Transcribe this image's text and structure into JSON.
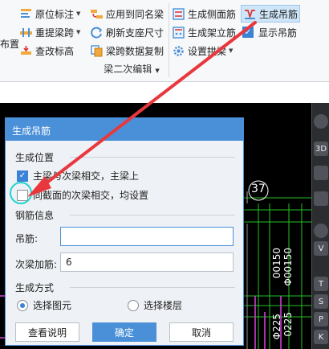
{
  "ribbon": {
    "left_fragment": "布置",
    "group_label": "梁二次编辑",
    "items": [
      {
        "label": "原位标注",
        "dropdown": true
      },
      {
        "label": "重提梁跨",
        "dropdown": true
      },
      {
        "label": "查改标高",
        "dropdown": false
      },
      {
        "label": "应用到同名梁",
        "dropdown": false
      },
      {
        "label": "刷新支座尺寸",
        "dropdown": false
      },
      {
        "label": "梁跨数据复制",
        "dropdown": false
      },
      {
        "label": "生成侧面筋",
        "dropdown": false
      },
      {
        "label": "生成架立筋",
        "dropdown": false
      },
      {
        "label": "设置拱梁",
        "dropdown": true
      },
      {
        "label": "生成吊筋",
        "dropdown": false
      },
      {
        "label": "显示吊筋",
        "dropdown": false
      }
    ]
  },
  "cad": {
    "labels": [
      "37",
      "00150",
      "Φ00150",
      "Φ225",
      "0225"
    ]
  },
  "toolbar": {
    "buttons": [
      "3D",
      "V",
      "T",
      "S",
      "P",
      "K"
    ]
  },
  "dialog": {
    "title": "生成吊筋",
    "section_position": "生成位置",
    "opt_main_secondary": "主梁与次梁相交，主梁上",
    "opt_same_section": "同截面的次梁相交，均设置",
    "opt_main_secondary_checked": true,
    "opt_same_section_checked": false,
    "section_rebar": "钢筋信息",
    "hanger_label": "吊筋:",
    "hanger_value": "",
    "secondary_label": "次梁加筋:",
    "secondary_value": "6",
    "section_method": "生成方式",
    "radio_select_element": "选择图元",
    "radio_select_floor": "选择楼层",
    "radio_selected": "选择图元",
    "btn_help": "查看说明",
    "btn_ok": "确定",
    "btn_cancel": "取消"
  },
  "colors": {
    "dialog_title_bg": "#4a90d9",
    "highlight_ring": "#21d4cf",
    "arrow": "#e8383d",
    "cad_background": "#000000",
    "cad_line_green": "#25c025",
    "cad_line_magenta": "#e040e0"
  }
}
